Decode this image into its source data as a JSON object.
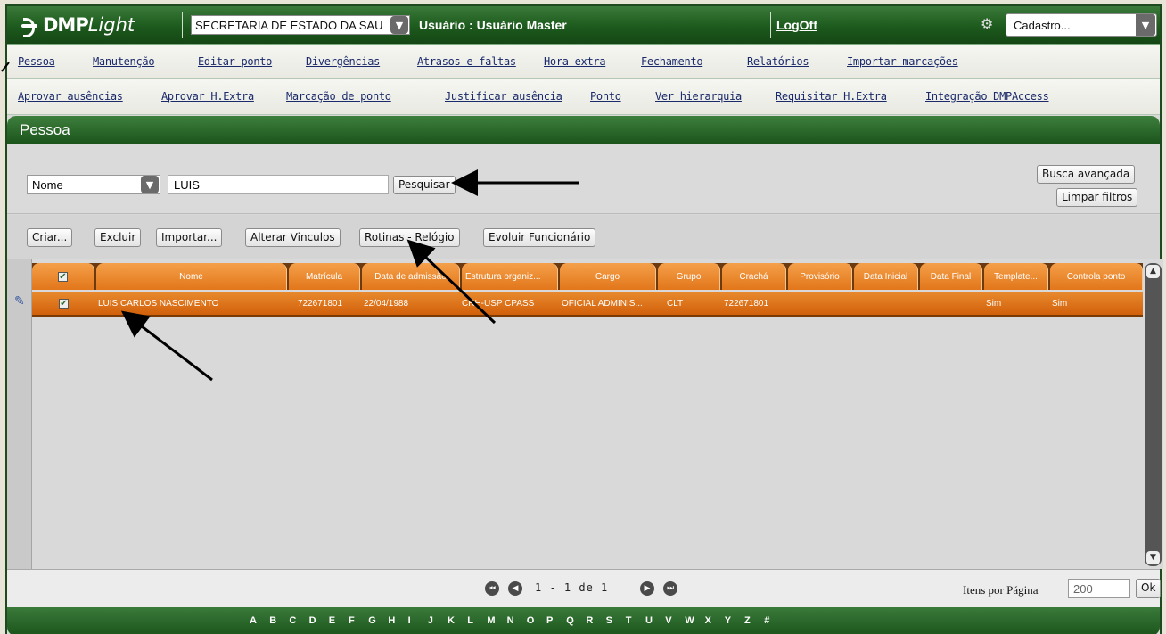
{
  "header": {
    "logo_text": "DMP",
    "logo_text_italic": "Light",
    "org_select": "SECRETARIA DE ESTADO DA SAU",
    "user_info": "Usuário : Usuário Master",
    "logoff": "LogOff",
    "menu_select": "Cadastro..."
  },
  "menu1": [
    "Pessoa",
    "Manutenção",
    "Editar ponto",
    "Divergências",
    "Atrasos e faltas",
    "Hora extra",
    "Fechamento",
    "Relatórios",
    "Importar marcações"
  ],
  "menu2": [
    "Aprovar ausências",
    "Aprovar H.Extra",
    "Marcação de ponto",
    "Justificar ausência",
    "Ponto",
    "Ver hierarquia",
    "Requisitar H.Extra",
    "Integração DMPAccess"
  ],
  "section_title": "Pessoa",
  "search": {
    "field": "Nome",
    "query": "LUIS",
    "search_button": "Pesquisar",
    "advanced_button": "Busca avançada",
    "clear_button": "Limpar filtros"
  },
  "toolbar": [
    "Criar...",
    "Excluir",
    "Importar...",
    "Alterar Vinculos",
    "Rotinas - Relógio",
    "Evoluir Funcionário"
  ],
  "grid": {
    "headers": [
      "Nome",
      "Matrícula",
      "Data de admissão",
      "Estrutura organiz...",
      "Cargo",
      "Grupo",
      "Crachá",
      "Provisório",
      "Data Inicial",
      "Data Final",
      "Template...",
      "Controla ponto"
    ],
    "row": {
      "nome": "LUIS CARLOS NASCIMENTO",
      "matricula": "722671801",
      "admissao": "22/04/1988",
      "estrutura": "CRH-USP CPASS",
      "cargo": "OFICIAL ADMINIS...",
      "grupo": "CLT",
      "cracha": "722671801",
      "template": "Sim",
      "controla": "Sim"
    }
  },
  "pager": {
    "text": "1 - 1 de 1",
    "items_label": "Itens por Página",
    "items_value": "200",
    "ok": "Ok"
  },
  "alphabet": [
    "A",
    "B",
    "C",
    "D",
    "E",
    "F",
    "G",
    "H",
    "I",
    "J",
    "K",
    "L",
    "M",
    "N",
    "O",
    "P",
    "Q",
    "R",
    "S",
    "T",
    "U",
    "V",
    "W",
    "X",
    "Y",
    "Z",
    "#"
  ]
}
